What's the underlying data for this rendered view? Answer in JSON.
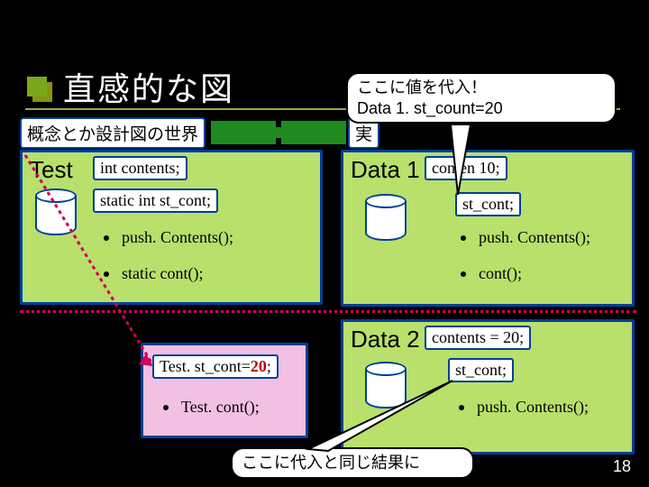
{
  "title": "直感的な図",
  "leftLabel": "概念とか設計図の世界",
  "rightLabel": "実",
  "concept": {
    "name": "Test",
    "field1": "int contents;",
    "field2": "static int st_cont;",
    "method1": "push. Contents();",
    "method2": "static cont();"
  },
  "data1": {
    "name": "Data 1",
    "field1_pre": "conten",
    "field1_post": " 10;",
    "field2": "st_cont;",
    "method1": "push. Contents();",
    "method2": "cont();"
  },
  "data2": {
    "name": "Data 2",
    "field1": "contents = 20;",
    "field2": "st_cont;",
    "method1": "push. Contents();"
  },
  "smallPanel": {
    "line1_pre": "Test. st_cont=",
    "line1_red": "20",
    "line1_post": ";",
    "method1": "Test. cont();"
  },
  "callout1": {
    "line1": "ここに値を代入！",
    "line2": "Data 1. st_count=20"
  },
  "callout2": "ここに代入と同じ結果に",
  "pageNum": "18"
}
